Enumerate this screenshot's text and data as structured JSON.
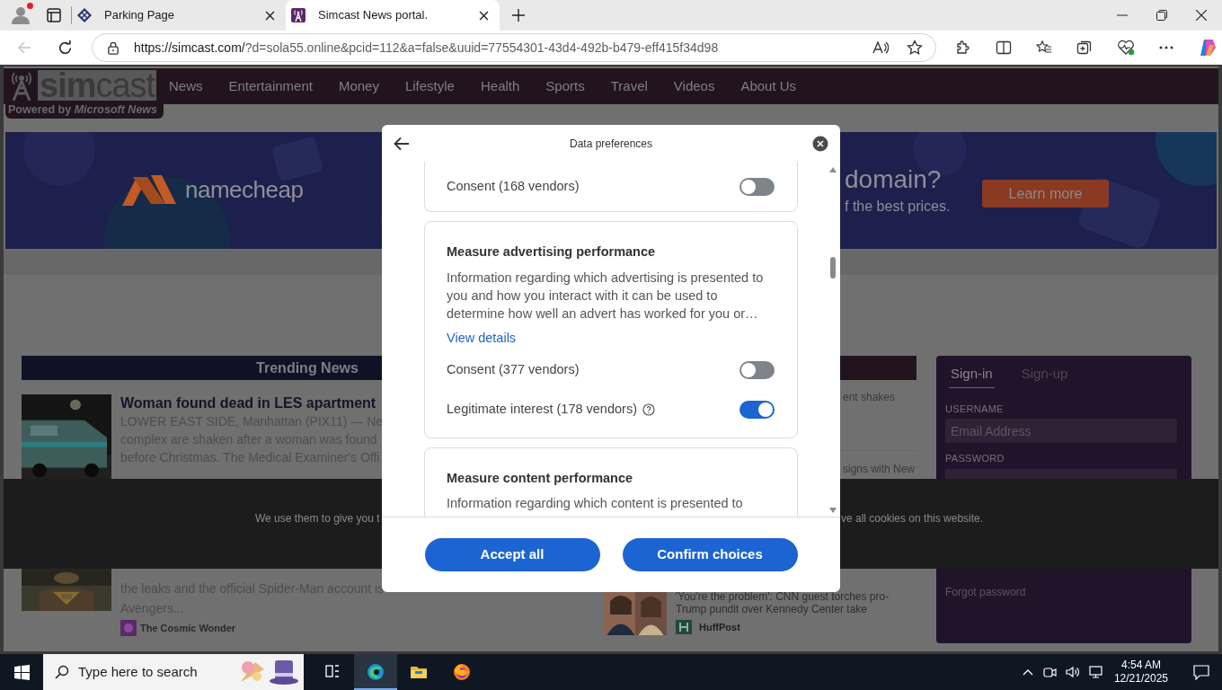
{
  "browser": {
    "tabs": [
      {
        "title": "Parking Page",
        "selected": false,
        "kind": "parking"
      },
      {
        "title": "Simcast News portal.",
        "selected": true,
        "kind": "simcast"
      }
    ],
    "url_host": "https://simcast.com/",
    "url_rest": "?d=sola55.online&pcid=112&a=false&uuid=77554301-43d4-492b-b479-eff415f34d98",
    "back_disabled": true
  },
  "site": {
    "logo": "**sim**cast",
    "tagline": "Powered by *Microsoft News*",
    "nav": [
      "News",
      "Entertainment",
      "Money",
      "Lifestyle",
      "Health",
      "Sports",
      "Travel",
      "Videos",
      "About Us"
    ],
    "banner": {
      "brand": "namecheap",
      "headline": "domain?",
      "subline": "f the best prices.",
      "button": "Learn more"
    },
    "trending": {
      "title": "Trending News",
      "articles": [
        {
          "title": "Woman found dead in LES apartment",
          "lines": [
            "LOWER EAST SIDE, Manhattan (PIX11) — Ne",
            "complex are shaken after a woman was found",
            "before Christmas. The Medical Examiner's Offi"
          ]
        },
        {
          "lines": [
            "the leaks and the official Spider-Man account is",
            "Avengers..."
          ],
          "source": "The Cosmic Wonder"
        }
      ]
    },
    "middle": {
      "fragments": [
        "ent shakes",
        "signs with New"
      ],
      "story": {
        "title": "'You're the problem': CNN guest torches pro-Trump pundit over Kennedy Center take",
        "source": "HuffPost"
      }
    },
    "signin": {
      "tabs": [
        {
          "label": "Sign-in",
          "selected": true
        },
        {
          "label": "Sign-up",
          "selected": false
        }
      ],
      "username_label": "USERNAME",
      "username_placeholder": "Email Address",
      "password_label": "PASSWORD",
      "forgot": "Forgot password"
    },
    "cookie_bar": {
      "left": "We use them to give you t",
      "right": "ve all cookies on this website."
    }
  },
  "dialog": {
    "title": "Data preferences",
    "top_toggles": [
      {
        "label": "Consent (168 vendors)",
        "on": false,
        "info": false
      }
    ],
    "sections": [
      {
        "title": "Measure advertising performance",
        "description": "Information regarding which advertising is presented to you and how you interact with it can be used to determine how well an advert has worked for you or…",
        "link": "View details",
        "toggles": [
          {
            "label": "Consent (377 vendors)",
            "on": false,
            "info": false
          },
          {
            "label": "Legitimate interest (178 vendors)",
            "on": true,
            "info": true
          }
        ]
      },
      {
        "title": "Measure content performance",
        "description": "Information regarding which content is presented to"
      }
    ],
    "buttons": [
      "Accept all",
      "Confirm choices"
    ]
  },
  "taskbar": {
    "search_placeholder": "Type here to search",
    "apps": [
      {
        "kind": "taskview",
        "selected": false
      },
      {
        "kind": "edge",
        "selected": true
      },
      {
        "kind": "explorer",
        "selected": false
      },
      {
        "kind": "firefox",
        "selected": false
      }
    ],
    "time": "4:54 AM",
    "date": "12/21/2025"
  }
}
